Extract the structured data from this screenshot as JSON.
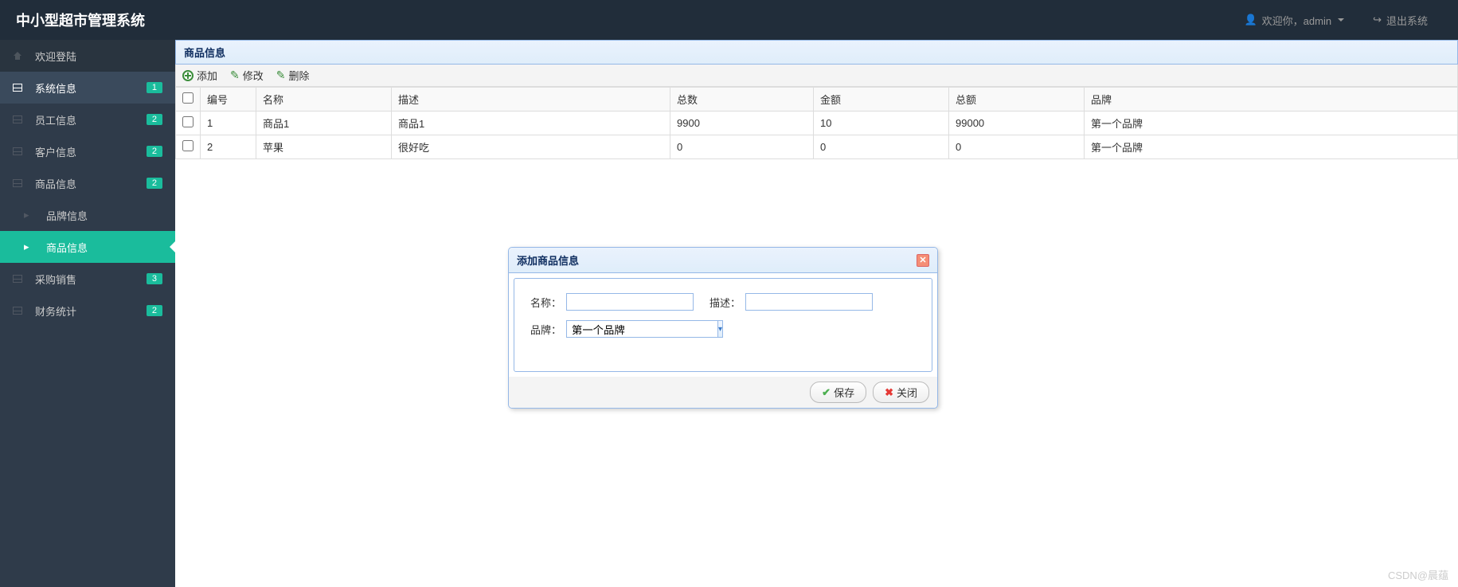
{
  "header": {
    "title": "中小型超市管理系统",
    "welcome": "欢迎你，admin",
    "logout": "退出系统"
  },
  "sidebar": {
    "home": "欢迎登陆",
    "items": [
      {
        "label": "系统信息",
        "badge": "1"
      },
      {
        "label": "员工信息",
        "badge": "2"
      },
      {
        "label": "客户信息",
        "badge": "2"
      },
      {
        "label": "商品信息",
        "badge": "2"
      },
      {
        "label": "采购销售",
        "badge": "3"
      },
      {
        "label": "财务统计",
        "badge": "2"
      }
    ],
    "sub": [
      {
        "label": "品牌信息"
      },
      {
        "label": "商品信息"
      }
    ]
  },
  "panel": {
    "title": "商品信息"
  },
  "toolbar": {
    "add": "添加",
    "edit": "修改",
    "del": "删除"
  },
  "table": {
    "headers": {
      "id": "编号",
      "name": "名称",
      "desc": "描述",
      "total": "总数",
      "amount": "金额",
      "sumtotal": "总额",
      "brand": "品牌"
    },
    "rows": [
      {
        "id": "1",
        "name": "商品1",
        "desc": "商品1",
        "total": "9900",
        "amount": "10",
        "sumtotal": "99000",
        "brand": "第一个品牌"
      },
      {
        "id": "2",
        "name": "苹果",
        "desc": "很好吃",
        "total": "0",
        "amount": "0",
        "sumtotal": "0",
        "brand": "第一个品牌"
      }
    ]
  },
  "dialog": {
    "title": "添加商品信息",
    "name_label": "名称：",
    "desc_label": "描述：",
    "brand_label": "品牌：",
    "brand_value": "第一个品牌",
    "save": "保存",
    "close": "关闭"
  },
  "watermark": "CSDN@晨蕴"
}
